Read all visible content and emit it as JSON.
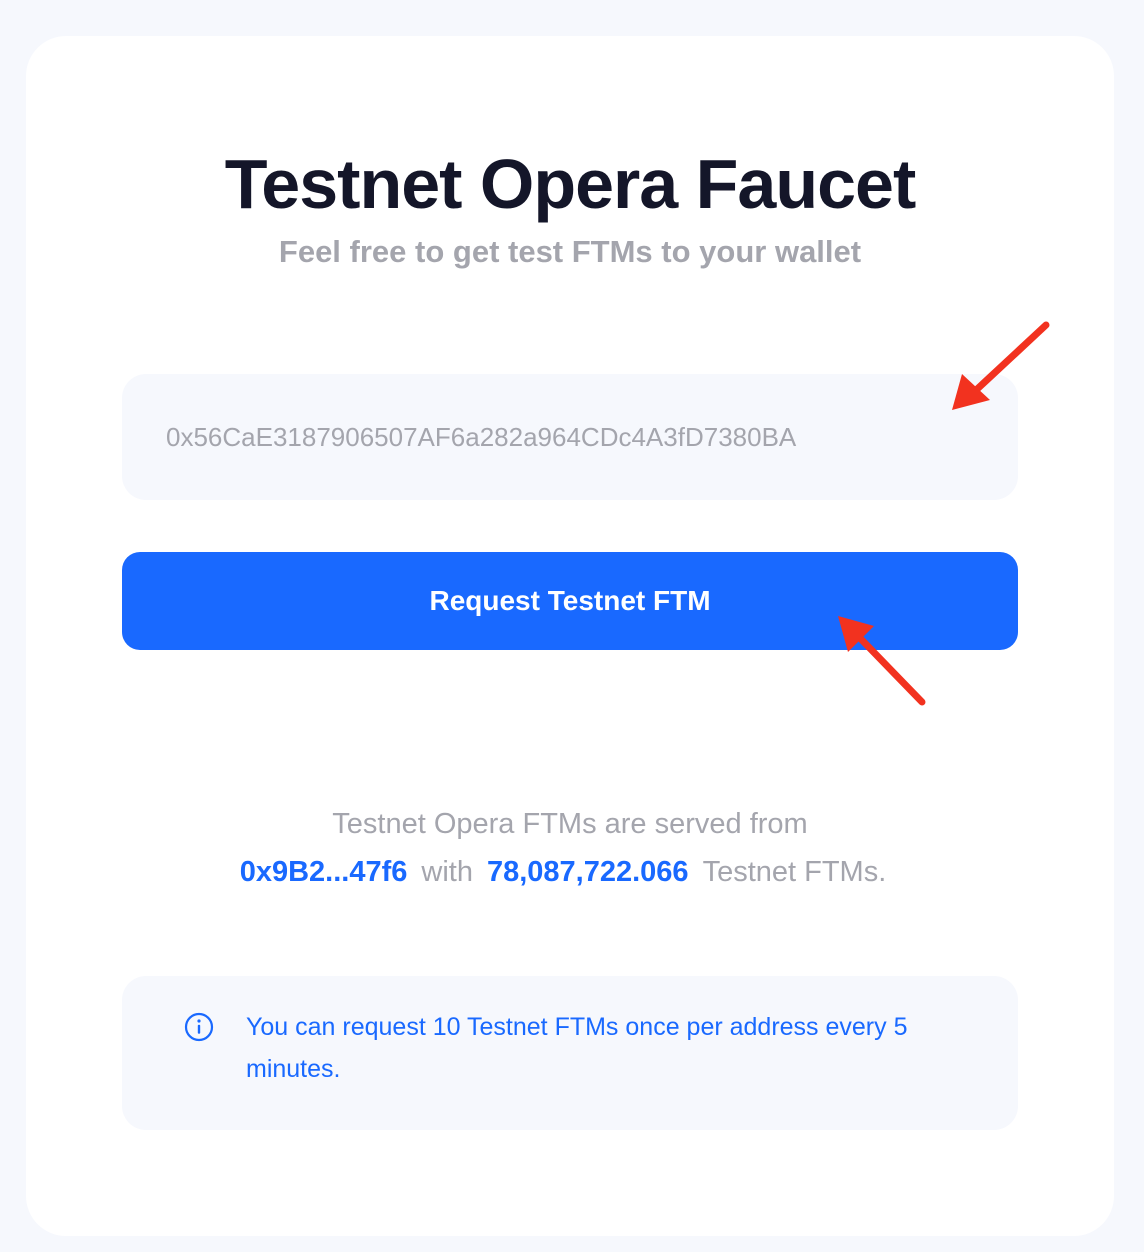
{
  "page": {
    "title": "Testnet Opera Faucet",
    "subtitle": "Feel free to get test FTMs to your wallet"
  },
  "form": {
    "address_value": "0x56CaE3187906507AF6a282a964CDc4A3fD7380BA",
    "request_button_label": "Request Testnet FTM"
  },
  "served": {
    "line1": "Testnet Opera FTMs are served from",
    "faucet_address": "0x9B2...47f6",
    "with_label": "with",
    "balance": "78,087,722.066",
    "unit_label": "Testnet FTMs."
  },
  "info": {
    "icon": "info-icon",
    "text": "You can request 10 Testnet FTMs once per address every 5 minutes."
  },
  "colors": {
    "accent": "#1969ff",
    "annotation": "#f2321f",
    "background": "#f6f8fd",
    "title": "#141629",
    "muted": "#a4a5ad"
  }
}
